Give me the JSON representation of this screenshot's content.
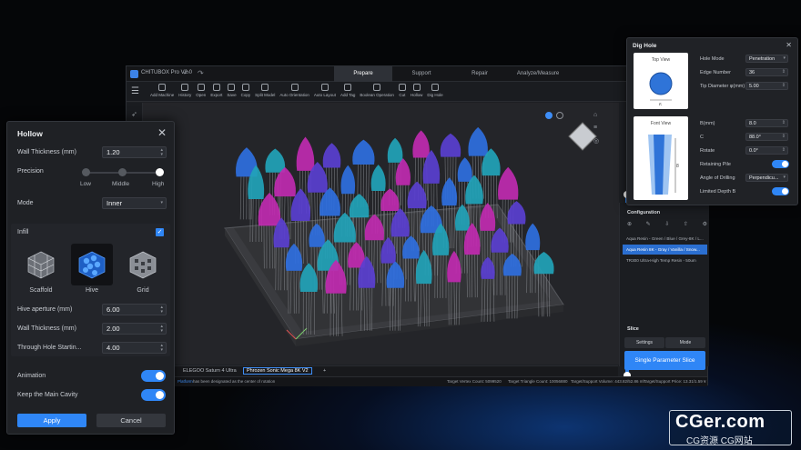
{
  "app": {
    "title": "CHITUBOX Pro V2.0",
    "mode_tabs": [
      "Prepare",
      "Support",
      "Repair",
      "Analyze/Measure"
    ],
    "active_tab": "Prepare"
  },
  "toolbar": {
    "items": [
      "Add Machine",
      "History",
      "Open",
      "Export",
      "Save",
      "Copy",
      "Split Model",
      "Auto Orientation",
      "Auto Layout",
      "Add Tag",
      "Boolean Operation",
      "Cut",
      "Hollow",
      "Dig Hole"
    ]
  },
  "bottom_tabs": {
    "items": [
      "ELEGOO Saturn 4 Ultra",
      "Phrozen Sonic Mega 8K V2"
    ],
    "active": "Phrozen Sonic Mega 8K V2",
    "add": "+"
  },
  "status": {
    "message_link": "Platform",
    "message": "has been designated as the center of rotation",
    "vertex": "Target Vertex Count: 5099520",
    "triangles": "Target Triangle Count: 10056880",
    "volume": "Target/Support Volume: 443.82/52.86 ml",
    "price": "Target/Support Price: 13.31/1.59 ¥"
  },
  "configuration": {
    "title": "Configuration",
    "items": [
      "Aqua Resin - Green / Blue / Grey-8K / L...",
      "Aqua Resin 8K - Gray / Vanilla / Snow...",
      "TR300 Ultra-High Temp Resin - 50um"
    ],
    "selected_index": 1
  },
  "slice": {
    "title": "Slice",
    "settings_label": "Settings",
    "mode_label": "Mode",
    "slice_button": "Single Parameter Slice"
  },
  "dig_hole": {
    "title": "Dig Hole",
    "top_view": "Top View",
    "front_view": "Font View",
    "top_view_mark": "6",
    "front_view_mark": "8",
    "fields": [
      {
        "label": "Hole Mode",
        "value": "Penetration"
      },
      {
        "label": "Edge Number",
        "value": "36"
      },
      {
        "label": "Tip Diameter φ(mm)",
        "value": "5.00"
      },
      {
        "label": "B(mm)",
        "value": "8.0"
      },
      {
        "label": "C",
        "value": "88.0°"
      },
      {
        "label": "Rotate",
        "value": "0.0°"
      },
      {
        "label": "Angle of Drilling",
        "value": "Perpendicu..."
      }
    ],
    "retaining_pile": "Retaining Pile",
    "limited_depth": "Limited Depth B"
  },
  "hollow": {
    "title": "Hollow",
    "wall_thickness_label": "Wall Thickness (mm)",
    "wall_thickness": "1.20",
    "precision_label": "Precision",
    "precision_levels": [
      "Low",
      "Middle",
      "High"
    ],
    "precision_value": "High",
    "mode_label": "Mode",
    "mode_value": "Inner",
    "infill_label": "Infill",
    "infill_enabled": true,
    "infill_types": [
      "Scaffold",
      "Hive",
      "Grid"
    ],
    "infill_selected": "Hive",
    "hive_aperture_label": "Hive aperture (mm)",
    "hive_aperture": "6.00",
    "infill_wall_thickness_label": "Wall Thickness (mm)",
    "infill_wall_thickness": "2.00",
    "through_hole_label": "Through Hole Startin...",
    "through_hole": "4.00",
    "animation_label": "Animation",
    "animation_on": true,
    "keep_cavity_label": "Keep the Main Cavity",
    "keep_cavity_on": true,
    "apply_label": "Apply",
    "cancel_label": "Cancel"
  },
  "watermark": {
    "line1": "CGer.com",
    "line2": "CG资源 CG网站"
  },
  "colors": {
    "accent": "#2f86f6",
    "panel": "#1f2125",
    "model_blue": "#2f6fe0",
    "model_teal": "#22a3b8",
    "model_magenta": "#c02ab0",
    "model_purple": "#5a3fd0"
  }
}
